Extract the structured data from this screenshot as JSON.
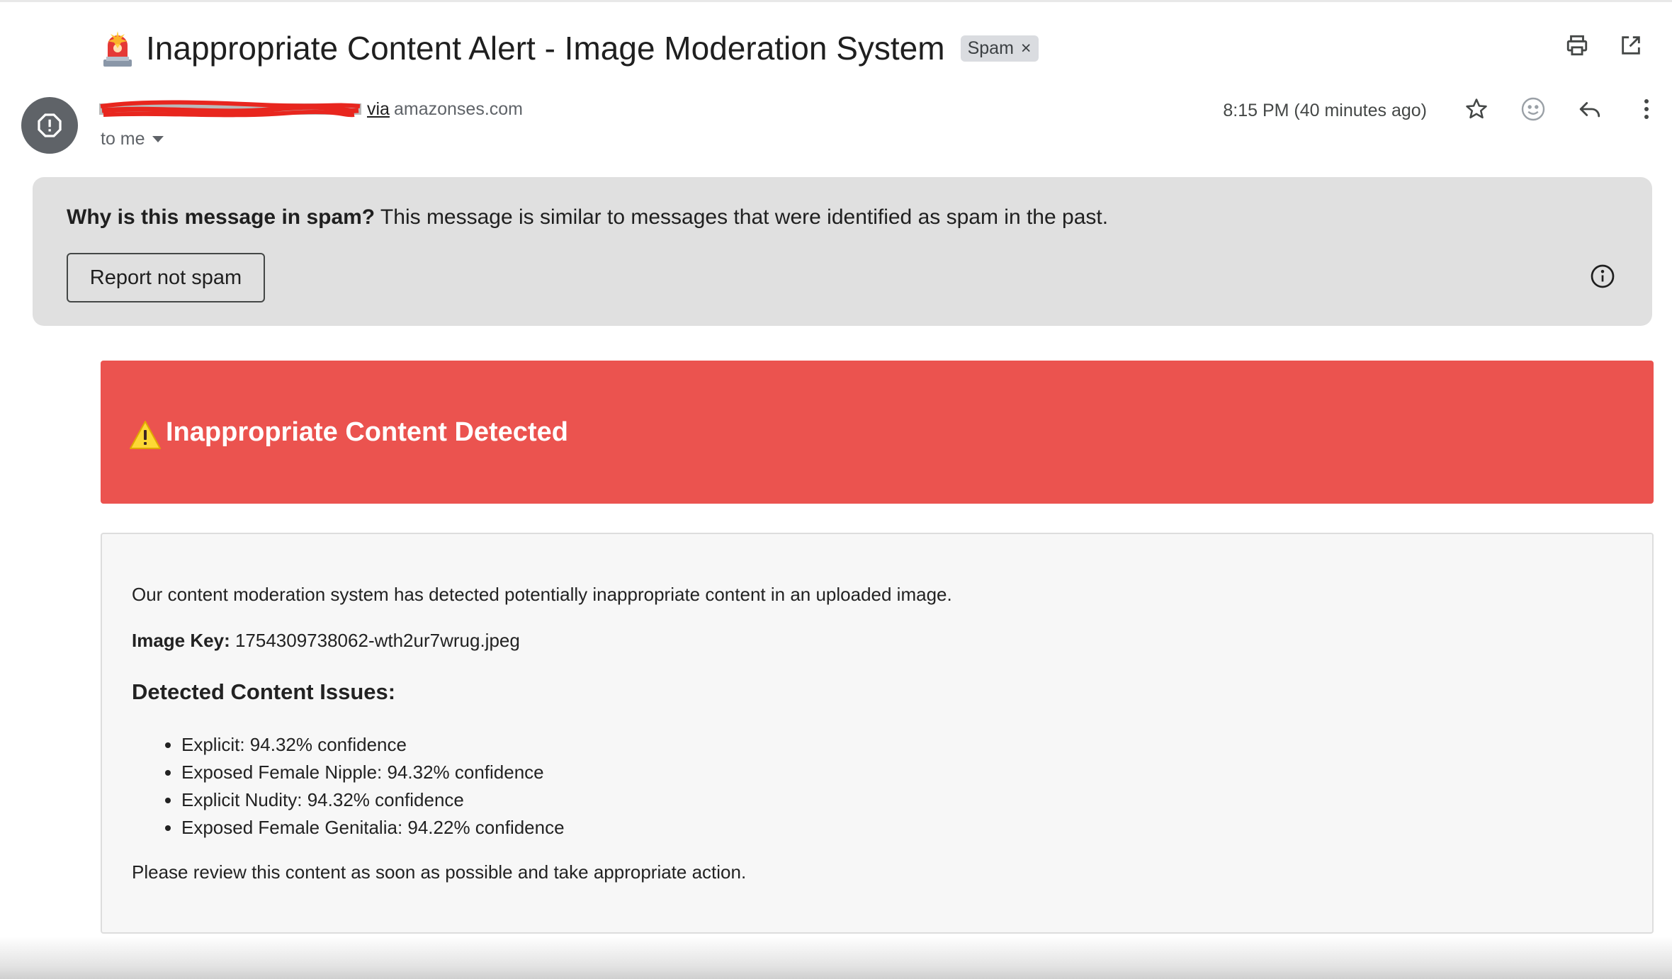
{
  "email": {
    "subject": "Inappropriate Content Alert - Image Moderation System",
    "label_chip": "Spam",
    "label_chip_close": "×",
    "sender_via": "via",
    "sender_domain": "amazonses.com",
    "recipient": "to me",
    "time": "8:15 PM (40 minutes ago)"
  },
  "spam_notice": {
    "question": "Why is this message in spam?",
    "explanation": " This message is similar to messages that were identified as spam in the past.",
    "report_button": "Report not spam"
  },
  "body": {
    "banner_title": "Inappropriate Content Detected",
    "intro": "Our content moderation system has detected potentially inappropriate content in an uploaded image.",
    "image_key_label": "Image Key:",
    "image_key_value": " 1754309738062-wth2ur7wrug.jpeg",
    "issues_heading": "Detected Content Issues:",
    "issues": [
      "Explicit: 94.32% confidence",
      "Exposed Female Nipple: 94.32% confidence",
      "Explicit Nudity: 94.32% confidence",
      "Exposed Female Genitalia: 94.22% confidence"
    ],
    "closing": "Please review this content as soon as possible and take appropriate action."
  },
  "icons": {
    "subject_icon": "siren-emoji",
    "print": "print-icon",
    "open_new_window": "open-in-new-icon",
    "avatar": "spam-warning-icon",
    "star": "star-icon",
    "emoji": "emoji-reaction-icon",
    "reply": "reply-icon",
    "more": "more-vert-icon",
    "info": "info-icon",
    "warning": "warning-emoji"
  },
  "colors": {
    "banner_red": "#eb534f",
    "spam_notice_bg": "#e0e0e0",
    "content_bg": "#f7f7f7",
    "avatar_gray": "#5f6368",
    "redaction_red": "#e8261e"
  }
}
